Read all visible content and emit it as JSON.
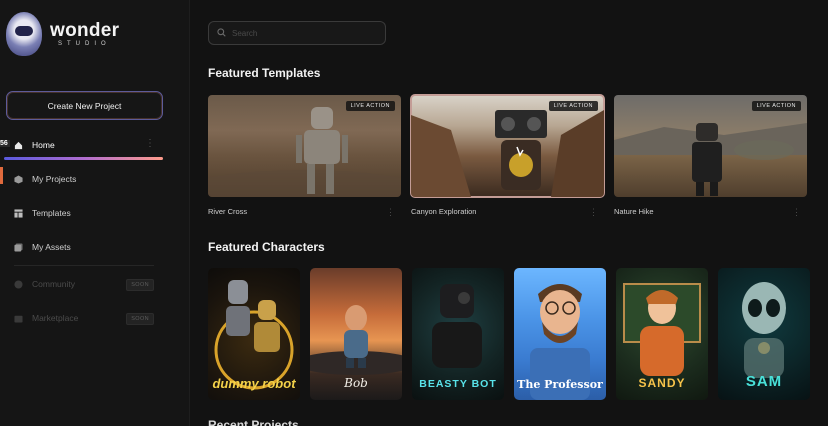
{
  "brand": {
    "name": "wonder",
    "sub": "STUDIO"
  },
  "sidebar": {
    "create_button": "Create New Project",
    "items": [
      {
        "label": "Home",
        "icon": "home-icon",
        "active": true
      },
      {
        "label": "My Projects",
        "icon": "cube-icon"
      },
      {
        "label": "Templates",
        "icon": "template-icon"
      },
      {
        "label": "My Assets",
        "icon": "assets-icon"
      },
      {
        "label": "Community",
        "icon": "globe-icon",
        "badge": "SOON"
      },
      {
        "label": "Marketplace",
        "icon": "marketplace-icon",
        "badge": "SOON"
      }
    ],
    "edge_badge": "56"
  },
  "search": {
    "placeholder": "Search"
  },
  "featured_templates": {
    "title": "Featured Templates",
    "items": [
      {
        "label": "River Cross",
        "tag": "LIVE ACTION"
      },
      {
        "label": "Canyon Exploration",
        "tag": "LIVE ACTION"
      },
      {
        "label": "Nature Hike",
        "tag": "LIVE ACTION"
      }
    ]
  },
  "featured_characters": {
    "title": "Featured Characters",
    "items": [
      {
        "name": "dummy robot"
      },
      {
        "name": "Bob"
      },
      {
        "name": "BEASTY BOT"
      },
      {
        "name": "The Professor"
      },
      {
        "name": "SANDY"
      },
      {
        "name": "SAM"
      }
    ]
  },
  "recent_projects": {
    "title": "Recent Projects"
  }
}
